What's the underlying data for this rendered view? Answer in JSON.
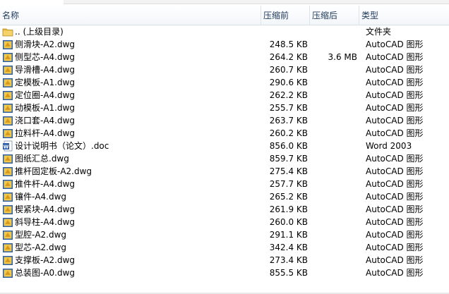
{
  "columns": {
    "name": "名称",
    "before": "压缩前",
    "after": "压缩后",
    "type": "类型"
  },
  "rows": [
    {
      "icon": "folder-icon",
      "name": ".. (上级目录)",
      "before": "",
      "after": "",
      "type": "文件夹"
    },
    {
      "icon": "dwg-file-icon",
      "name": "侧滑块-A2.dwg",
      "before": "248.5 KB",
      "after": "",
      "type": "AutoCAD 图形"
    },
    {
      "icon": "dwg-file-icon",
      "name": "侧型芯-A4.dwg",
      "before": "264.2 KB",
      "after": "3.6 MB",
      "type": "AutoCAD 图形"
    },
    {
      "icon": "dwg-file-icon",
      "name": "导滑槽-A4.dwg",
      "before": "260.7 KB",
      "after": "",
      "type": "AutoCAD 图形"
    },
    {
      "icon": "dwg-file-icon",
      "name": "定模板-A1.dwg",
      "before": "290.6 KB",
      "after": "",
      "type": "AutoCAD 图形"
    },
    {
      "icon": "dwg-file-icon",
      "name": "定位圈-A4.dwg",
      "before": "262.2 KB",
      "after": "",
      "type": "AutoCAD 图形"
    },
    {
      "icon": "dwg-file-icon",
      "name": "动模板-A1.dwg",
      "before": "255.7 KB",
      "after": "",
      "type": "AutoCAD 图形"
    },
    {
      "icon": "dwg-file-icon",
      "name": "浇口套-A4.dwg",
      "before": "263.7 KB",
      "after": "",
      "type": "AutoCAD 图形"
    },
    {
      "icon": "dwg-file-icon",
      "name": "拉料杆-A4.dwg",
      "before": "260.2 KB",
      "after": "",
      "type": "AutoCAD 图形"
    },
    {
      "icon": "word-file-icon",
      "name": "设计说明书（论文）.doc",
      "before": "856.0 KB",
      "after": "",
      "type": "Word 2003"
    },
    {
      "icon": "dwg-file-icon",
      "name": "图纸汇总.dwg",
      "before": "859.7 KB",
      "after": "",
      "type": "AutoCAD 图形"
    },
    {
      "icon": "dwg-file-icon",
      "name": "推杆固定板-A2.dwg",
      "before": "275.4 KB",
      "after": "",
      "type": "AutoCAD 图形"
    },
    {
      "icon": "dwg-file-icon",
      "name": "推件杆-A4.dwg",
      "before": "257.7 KB",
      "after": "",
      "type": "AutoCAD 图形"
    },
    {
      "icon": "dwg-file-icon",
      "name": "镶件-A4.dwg",
      "before": "265.2 KB",
      "after": "",
      "type": "AutoCAD 图形"
    },
    {
      "icon": "dwg-file-icon",
      "name": "楔紧块-A4.dwg",
      "before": "261.9 KB",
      "after": "",
      "type": "AutoCAD 图形"
    },
    {
      "icon": "dwg-file-icon",
      "name": "斜导柱-A4.dwg",
      "before": "260.0 KB",
      "after": "",
      "type": "AutoCAD 图形"
    },
    {
      "icon": "dwg-file-icon",
      "name": "型腔-A2.dwg",
      "before": "291.1 KB",
      "after": "",
      "type": "AutoCAD 图形"
    },
    {
      "icon": "dwg-file-icon",
      "name": "型芯-A2.dwg",
      "before": "342.4 KB",
      "after": "",
      "type": "AutoCAD 图形"
    },
    {
      "icon": "dwg-file-icon",
      "name": "支撑板-A2.dwg",
      "before": "273.4 KB",
      "after": "",
      "type": "AutoCAD 图形"
    },
    {
      "icon": "dwg-file-icon",
      "name": "总装图-A0.dwg",
      "before": "855.5 KB",
      "after": "",
      "type": "AutoCAD 图形"
    }
  ],
  "colors": {
    "header_text": "#1e395b",
    "folder": "#e8b83a",
    "dwg_sheet": "#f2c84b",
    "dwg_frame": "#2b5fa8",
    "word_blue": "#2a5caa"
  }
}
